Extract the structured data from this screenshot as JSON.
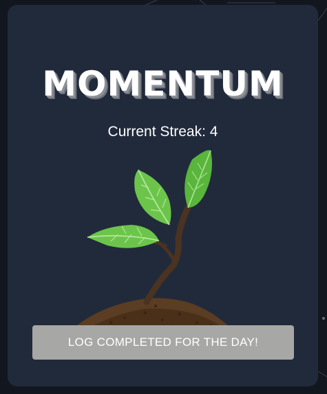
{
  "app": {
    "title": "MOMENTUM"
  },
  "streak": {
    "label": "Current Streak:",
    "value": "4"
  },
  "actions": {
    "log_button_label": "LOG COMPLETED FOR THE DAY!"
  },
  "colors": {
    "card_background": "#212a3b",
    "page_background": "#12161f",
    "button_background": "#a7a7a5",
    "title_shadow": "#8c8f96",
    "leaf_green": "#6cc54a",
    "stem_brown": "#4a3320",
    "soil_brown": "#5a3d22"
  },
  "icons": {
    "plant": "sprout-illustration"
  }
}
